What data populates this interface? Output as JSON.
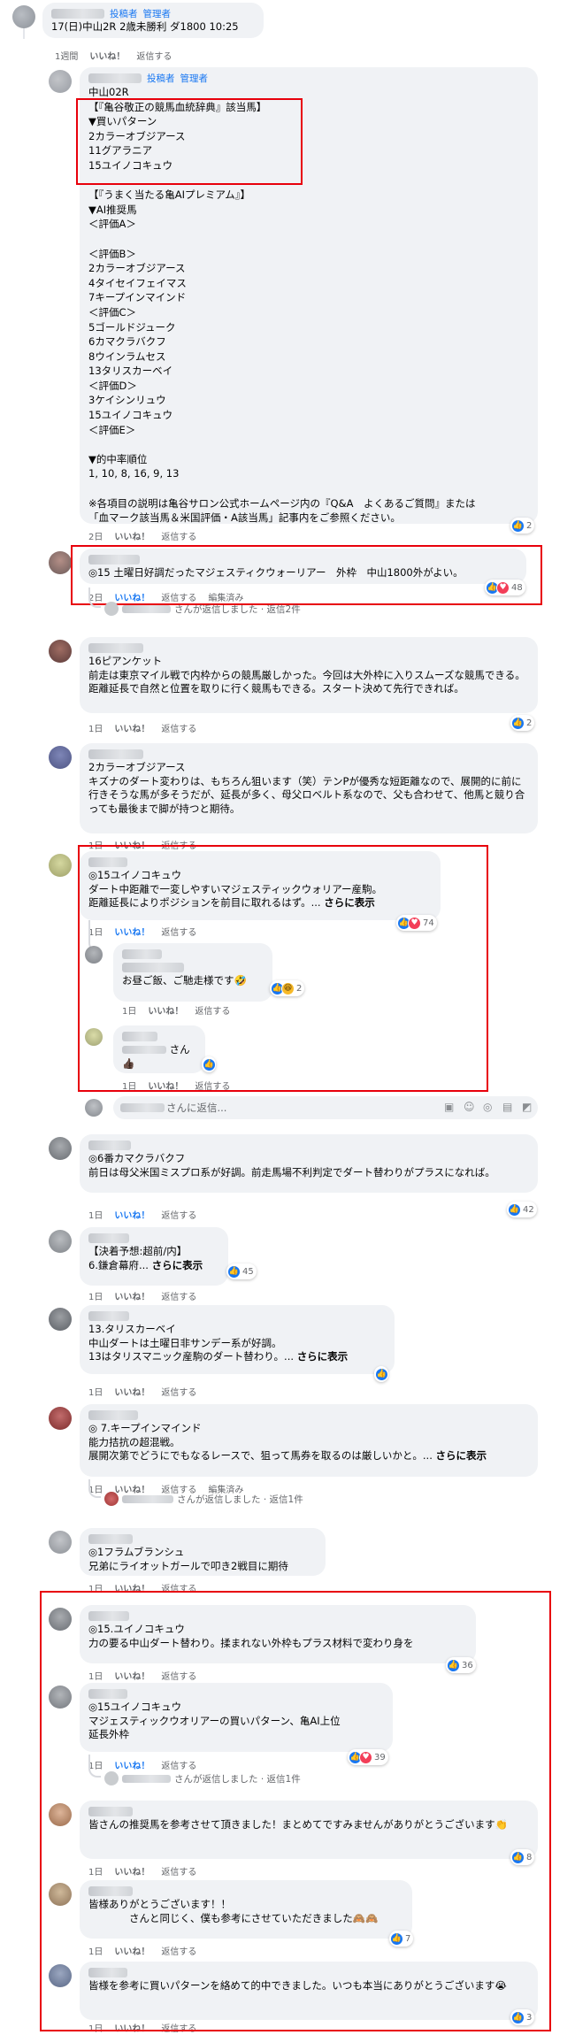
{
  "roles": {
    "poster": "投稿者",
    "admin": "管理者"
  },
  "actions": {
    "like": "いいね！",
    "reply": "返信する",
    "edit": "編集済み",
    "show_more": "さらに表示"
  },
  "c0": {
    "text": "17(日)中山2R 2歳未勝利 ダ1800 10:25",
    "time": "1週間"
  },
  "c1": {
    "lines": [
      "中山02R",
      "【『亀谷敬正の競馬血統辞典』該当馬】",
      "▼買いパターン",
      "2カラーオブジアース",
      "11グアラニア",
      "15ユイノコキュウ",
      "",
      "【『うまく当たる亀AIプレミアム』】",
      "▼AI推奨馬",
      "＜評価A＞",
      "",
      "＜評価B＞",
      "2カラーオブジアース",
      "4タイセイフェイマス",
      "7キープインマインド",
      "＜評価C＞",
      "5ゴールドジューク",
      "6カマクラバクフ",
      "8ウインラムセス",
      "13タリスカーベイ",
      "＜評価D＞",
      "3ケイシンリュウ",
      "15ユイノコキュウ",
      "＜評価E＞",
      "",
      "▼的中率順位",
      "1, 10, 8, 16, 9, 13",
      "",
      "※各項目の説明は亀谷サロン公式ホームページ内の『Q&A　よくあるご質問』または",
      "「血マーク該当馬＆米国評価・A該当馬」記事内をご参照ください。"
    ],
    "time": "2日",
    "rc": "2"
  },
  "c2": {
    "text": "◎15 土曜日好調だったマジェスティクウォーリアー　外枠　中山1800外がよい。",
    "time": "2日",
    "rc": "48",
    "replies": "さんが返信しました · 返信2件"
  },
  "c3": {
    "text": "16ピアンケット\n前走は東京マイル戦で内枠からの競馬厳しかった。今回は大外枠に入りスムーズな競馬できる。距離延長で自然と位置を取りに行く競馬もできる。スタート決めて先行できれば。",
    "time": "1日",
    "rc": "2"
  },
  "c4": {
    "text": "2カラーオブジアース\nキズナのダート変わりは、もちろん狙います（笑）テンPが優秀な短距離なので、展開的に前に行きそうな馬が多そうだが、延長が多く、母父ロベルト系なので、父も合わせて、他馬と競り合っても最後まで脚が持つと期待。",
    "time": "1日"
  },
  "c5": {
    "text": "◎15ユイノコキュウ\nダート中距離で一変しやすいマジェスティックウォリアー産駒。\n距離延長によりポジションを前目に取れるはず。...",
    "time": "1日",
    "rc": "74"
  },
  "r51": {
    "text": "お昼ご飯、ご馳走様です🤣",
    "time": "1日",
    "rc": "2"
  },
  "r52": {
    "text": "さん\n👍🏿",
    "time": "1日"
  },
  "input": {
    "placeholder": "さんに返信..."
  },
  "c6": {
    "text": "◎6番カマクラバクフ\n前日は母父米国ミスプロ系が好調。前走馬場不利判定でダート替わりがプラスになれば。",
    "time": "1日",
    "rc": "42"
  },
  "c7": {
    "text": "【決着予想:超前/内】\n6.鎌倉幕府...",
    "time": "1日",
    "rc": "45"
  },
  "c8": {
    "text": "13.タリスカーベイ\n中山ダートは土曜日非サンデー系が好調。\n13はタリスマニック産駒のダート替わり。...",
    "time": "1日"
  },
  "c9": {
    "text": "◎ 7.キープインマインド\n能力拮抗の超混戦。\n展開次第でどうにでもなるレースで、狙って馬券を取るのは厳しいかと。... ",
    "time": "1日",
    "replies": "さんが返信しました · 返信1件"
  },
  "c10": {
    "text": "◎1フラムブランシュ\n兄弟にライオットガールで叩き2戦目に期待",
    "time": "1日"
  },
  "c11": {
    "text": "◎15.ユイノコキュウ\n力の要る中山ダート替わり。揉まれない外枠もプラス材料で変わり身を",
    "time": "1日",
    "rc": "36"
  },
  "c12": {
    "text": "◎15ユイノコキュウ\nマジェスティックウオリアーの買いパターン、亀AI上位\n延長外枠",
    "time": "1日",
    "rc": "39",
    "replies": "さんが返信しました · 返信1件"
  },
  "c13": {
    "text": "皆さんの推奨馬を参考させて頂きました！まとめてですみませんがありがとうございます👏",
    "time": "1日",
    "rc": "8"
  },
  "c14": {
    "text": "皆様ありがとうございます！！\n　　　　さんと同じく、僕も参考にさせていただきました🙈🙈",
    "time": "1日",
    "rc": "7"
  },
  "c15": {
    "text": "皆様を参考に買いパターンを絡めて的中できました。いつも本当にありがとうございます😭",
    "time": "1日",
    "rc": "3"
  }
}
